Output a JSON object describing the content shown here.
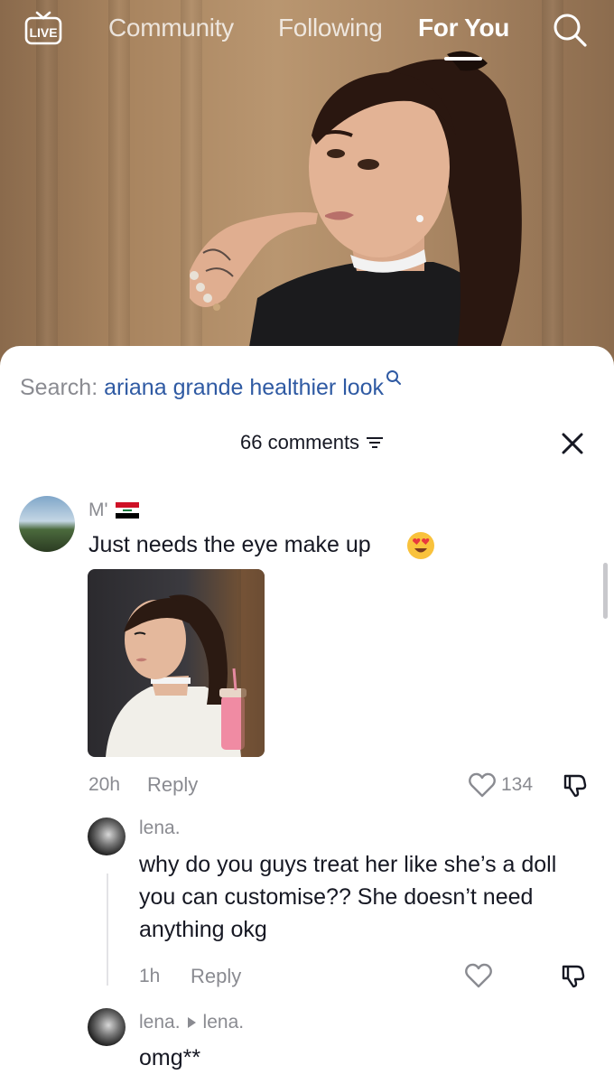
{
  "nav": {
    "live_label": "LIVE",
    "tabs": [
      {
        "label": "Community",
        "active": false
      },
      {
        "label": "Following",
        "active": false
      },
      {
        "label": "For You",
        "active": true
      }
    ],
    "search_icon": "search-icon"
  },
  "sheet": {
    "search_prefix": "Search:",
    "search_query": "ariana grande healthier look",
    "comment_count": "66 comments",
    "close_icon": "close-icon",
    "filter_icon": "filter-icon"
  },
  "comments": [
    {
      "username": "M'",
      "flag_icon": "iraq-flag-icon",
      "text": "Just needs the eye make up",
      "emoji_icon": "heart-eyes-emoji-icon",
      "has_image": true,
      "time": "20h",
      "reply_label": "Reply",
      "likes": "134",
      "replies": [
        {
          "username": "lena.",
          "text": "why do you guys treat her like she’s a doll you can customise?? She doesn’t need anything okg",
          "time": "1h",
          "reply_label": "Reply"
        },
        {
          "username": "lena.",
          "reply_to": "lena.",
          "text": "omg**"
        }
      ]
    }
  ],
  "colors": {
    "link_blue": "#2f5aa3",
    "muted_text": "#8a8b91",
    "primary_text": "#161823"
  }
}
